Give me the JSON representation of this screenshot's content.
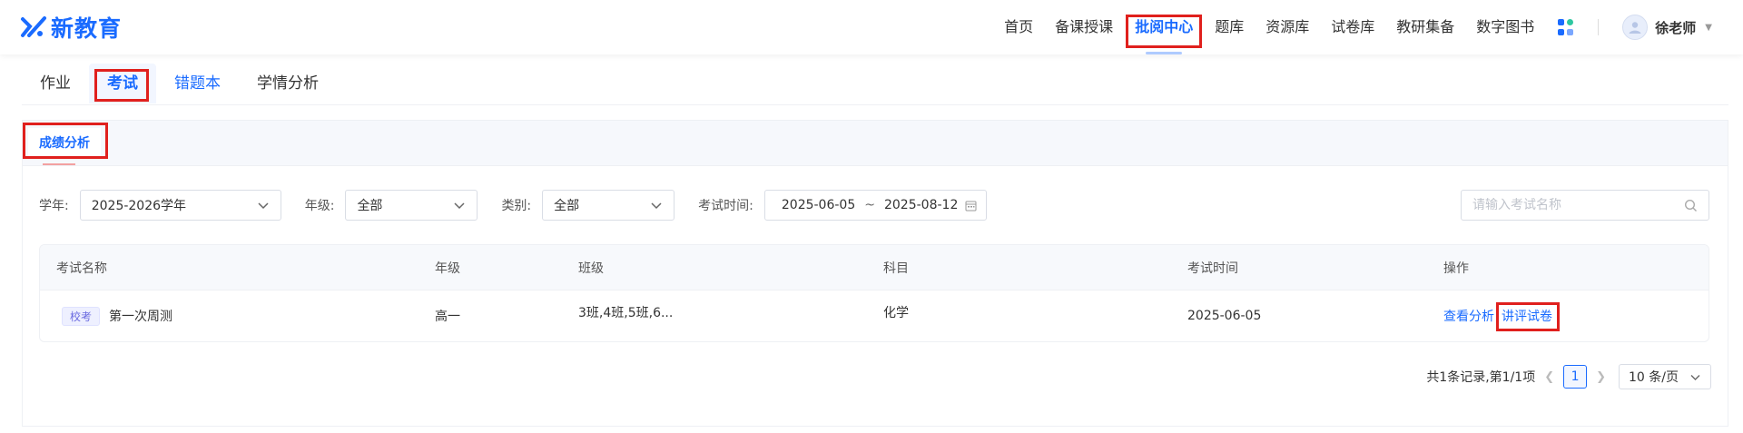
{
  "brand": {
    "name": "新教育",
    "color": "#1a6bff"
  },
  "nav": {
    "items": [
      {
        "label": "首页",
        "active": false
      },
      {
        "label": "备课授课",
        "active": false
      },
      {
        "label": "批阅中心",
        "active": true
      },
      {
        "label": "题库",
        "active": false
      },
      {
        "label": "资源库",
        "active": false
      },
      {
        "label": "试卷库",
        "active": false
      },
      {
        "label": "教研集备",
        "active": false
      },
      {
        "label": "数字图书",
        "active": false
      }
    ],
    "apps_icon": "apps-grid-icon",
    "user": {
      "name": "徐老师",
      "avatar_icon": "user-avatar-icon",
      "caret_icon": "caret-down-icon"
    }
  },
  "subtabs": [
    {
      "label": "作业",
      "active": false
    },
    {
      "label": "考试",
      "active": true
    },
    {
      "label": "错题本",
      "active": false
    },
    {
      "label": "学情分析",
      "active": false
    }
  ],
  "panel": {
    "tab": "成绩分析"
  },
  "filters": {
    "year": {
      "label": "学年:",
      "value": "2025-2026学年"
    },
    "grade": {
      "label": "年级:",
      "value": "全部"
    },
    "category": {
      "label": "类别:",
      "value": "全部"
    },
    "time": {
      "label": "考试时间:",
      "start": "2025-06-05",
      "separator": "~",
      "end": "2025-08-12"
    },
    "search": {
      "placeholder": "请输入考试名称",
      "value": ""
    }
  },
  "table": {
    "columns": [
      "考试名称",
      "年级",
      "班级",
      "科目",
      "考试时间",
      "操作"
    ],
    "rows": [
      {
        "badge": "校考",
        "name": "第一次周测",
        "grade": "高一",
        "classes": "3班,4班,5班,6...",
        "subject": "化学",
        "time": "2025-06-05",
        "actions": [
          "查看分析",
          "讲评试卷"
        ]
      }
    ]
  },
  "pagination": {
    "summary": "共1条记录,第1/1项",
    "current": "1",
    "page_size": "10 条/页",
    "prev_icon": "chevron-left-icon",
    "next_icon": "chevron-right-icon"
  },
  "colors": {
    "accent": "#1a6bff",
    "highlight": "#e0201d"
  }
}
